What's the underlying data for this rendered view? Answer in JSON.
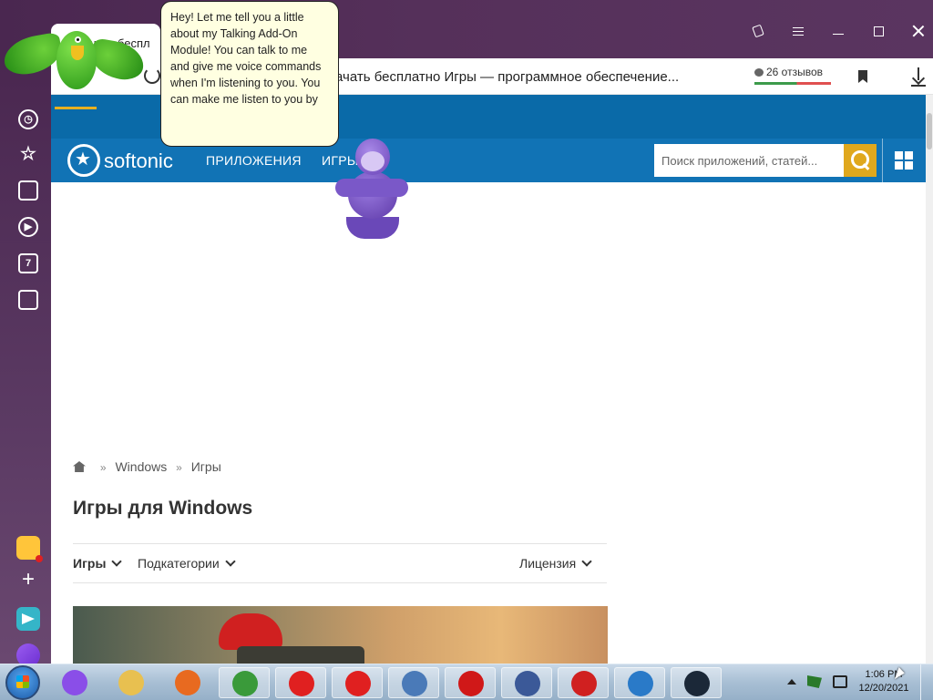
{
  "browser": {
    "tab_title": "качать беспл",
    "page_title": "ачать бесплатно Игры — программное обеспечение...",
    "reviews_label": "26 отзывов",
    "side_panel_badge": "7"
  },
  "assistant_bubble": {
    "text": "Hey! Let me tell you a little about my Talking Add-On Module! You can talk to me and give me voice commands when I'm listening to you. You can make me listen to you by"
  },
  "site": {
    "logo_text": "softonic",
    "nav": [
      {
        "label": "ПРИЛОЖЕНИЯ"
      },
      {
        "label": "ИГРЫ"
      }
    ],
    "search_placeholder": "Поиск приложений, статей..."
  },
  "breadcrumb": {
    "sep": "»",
    "items": [
      "Windows",
      "Игры"
    ]
  },
  "page": {
    "heading": "Игры для Windows"
  },
  "filters": {
    "games": "Игры",
    "subcategories": "Подкатегории",
    "license": "Лицензия"
  },
  "taskbar": {
    "apps": [
      {
        "name": "alice",
        "color": "#8a4ee8"
      },
      {
        "name": "file-explorer",
        "color": "#e8c050"
      },
      {
        "name": "firefox",
        "color": "#e86a20"
      },
      {
        "name": "chrome",
        "color": "#3a9a3a"
      },
      {
        "name": "yandex-browser",
        "color": "#e02020"
      },
      {
        "name": "yandex",
        "color": "#e02020"
      },
      {
        "name": "network-app",
        "color": "#4a7ab8"
      },
      {
        "name": "opera",
        "color": "#d01818"
      },
      {
        "name": "facebook",
        "color": "#3b5998"
      },
      {
        "name": "acrobat",
        "color": "#d02020"
      },
      {
        "name": "bonzi-app",
        "color": "#2a7ac8"
      },
      {
        "name": "steam",
        "color": "#1b2838"
      }
    ],
    "clock_time": "1:06 PM",
    "clock_date": "12/20/2021"
  },
  "colors": {
    "brand_blue": "#1173b5",
    "search_button": "#e0a81d",
    "browser_chrome": "#4a2750"
  }
}
